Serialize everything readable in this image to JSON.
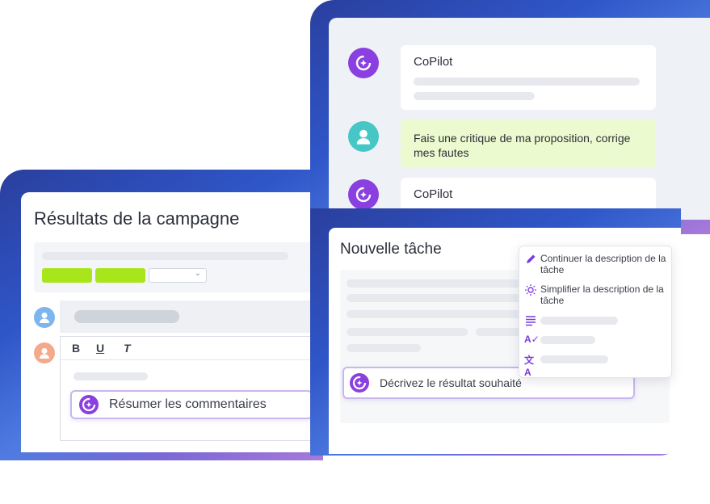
{
  "left_card": {
    "title": "Résultats de la campagne",
    "toolbar": {
      "bold": "B",
      "underline": "U",
      "italic": "T"
    },
    "summarize_label": "Résumer les commentaires"
  },
  "chat_card": {
    "messages": [
      {
        "sender": "CoPilot"
      },
      {
        "text": "Fais une critique de ma proposition, corrige mes fautes"
      },
      {
        "sender": "CoPilot"
      }
    ]
  },
  "task_card": {
    "title": "Nouvelle tâche",
    "prompt_placeholder": "Décrivez le résultat souhaité",
    "menu": [
      {
        "icon": "pen-icon",
        "label": "Continuer la description de la tâche"
      },
      {
        "icon": "sparkle-sun-icon",
        "label": "Simplifier la description de la tâche"
      },
      {
        "icon": "list-lines-icon",
        "label": ""
      },
      {
        "icon": "spell-check-icon",
        "label": ""
      },
      {
        "icon": "translate-icon",
        "label": ""
      }
    ]
  },
  "colors": {
    "brand_purple": "#8a3fe0",
    "accent_lime": "#a8e51b",
    "user_teal": "#46c7c6",
    "frame_blue": "#2f56c8"
  }
}
